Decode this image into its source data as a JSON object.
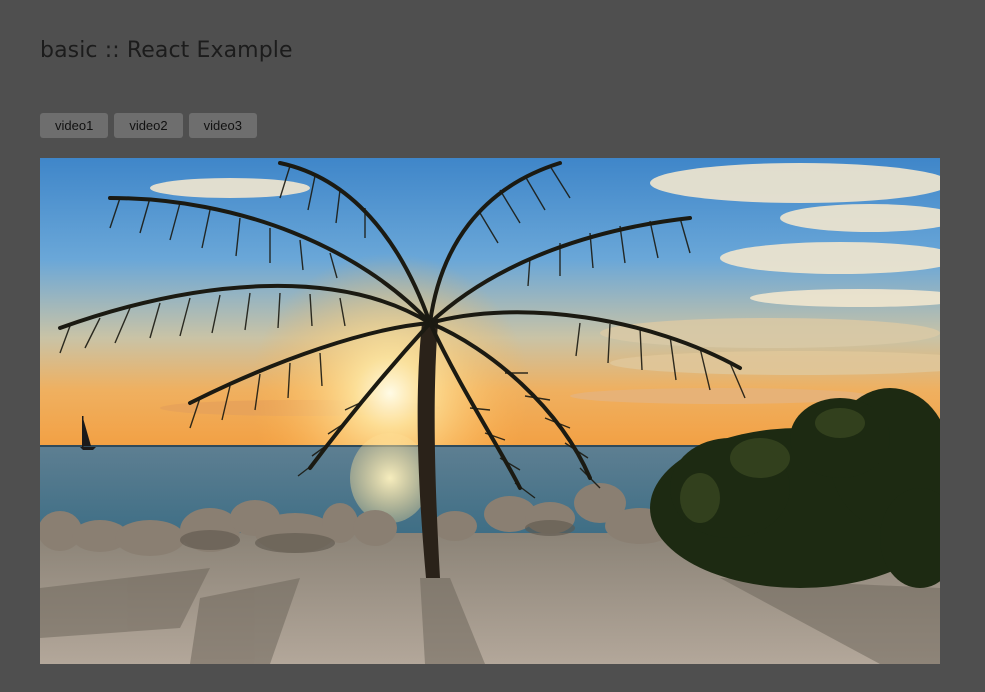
{
  "page": {
    "title": "basic :: React Example",
    "background_color": "#4f4f4f"
  },
  "toolbar": {
    "buttons": [
      {
        "label": "video1"
      },
      {
        "label": "video2"
      },
      {
        "label": "video3"
      }
    ]
  },
  "player": {
    "scene": "palm tree silhouette at sunset on a beach with a sailboat on the horizon"
  }
}
